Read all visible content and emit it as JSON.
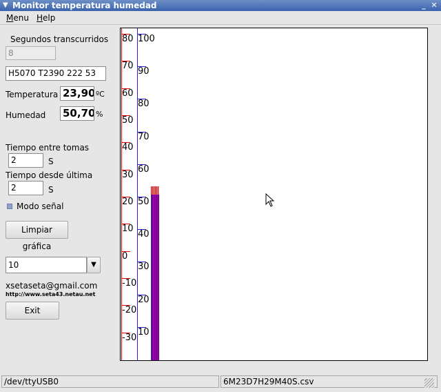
{
  "window": {
    "title": "Monitor temperatura humedad"
  },
  "menu": {
    "items": [
      {
        "label": "Menu",
        "underline": "M",
        "rest": "enu"
      },
      {
        "label": "Help",
        "underline": "H",
        "rest": "elp"
      }
    ]
  },
  "panel": {
    "elapsed_label": "Segundos transcurridos",
    "elapsed_value": "8",
    "raw_reading": "H5070 T2390 222 53",
    "temperature_label": "Temperatura",
    "temperature_value": "23,90",
    "temperature_unit": "ºC",
    "humidity_label": "Humedad",
    "humidity_value": "50,70",
    "humidity_unit": "%",
    "interval_label": "Tiempo entre tomas",
    "interval_value": "2",
    "interval_unit": "S",
    "since_last_label": "Tiempo desde última",
    "since_last_value": "2",
    "since_last_unit": "S",
    "signal_mode_label": "Modo señal",
    "clear_button": "Limpiar gráfica",
    "combo_value": "10",
    "email": "xsetaseta@gmail.com",
    "url": "http://www.seta43.netau.net",
    "exit_button": "Exit"
  },
  "chart_data": {
    "type": "bar",
    "series": [
      {
        "name": "",
        "axis": "temperature",
        "values": [
          23.9
        ]
      },
      {
        "name": "",
        "axis": "humidity",
        "values": [
          50.7
        ]
      }
    ],
    "temperature_axis": {
      "ticks": [
        "80",
        "70",
        "60",
        "50",
        "40",
        "30",
        "20",
        "10",
        "0",
        "-10",
        "-20",
        "-30"
      ],
      "range": [
        -40,
        80
      ]
    },
    "humidity_axis": {
      "ticks": [
        "100",
        "90",
        "80",
        "70",
        "60",
        "50",
        "40",
        "30",
        "20",
        "10"
      ],
      "range": [
        0,
        100
      ]
    },
    "colors": {
      "temperature": "#e00000",
      "humidity": "#2020d0",
      "bar_fill": "#800090"
    }
  },
  "status": {
    "port": "/dev/ttyUSB0",
    "file": "6M23D7H29M40S.csv"
  }
}
